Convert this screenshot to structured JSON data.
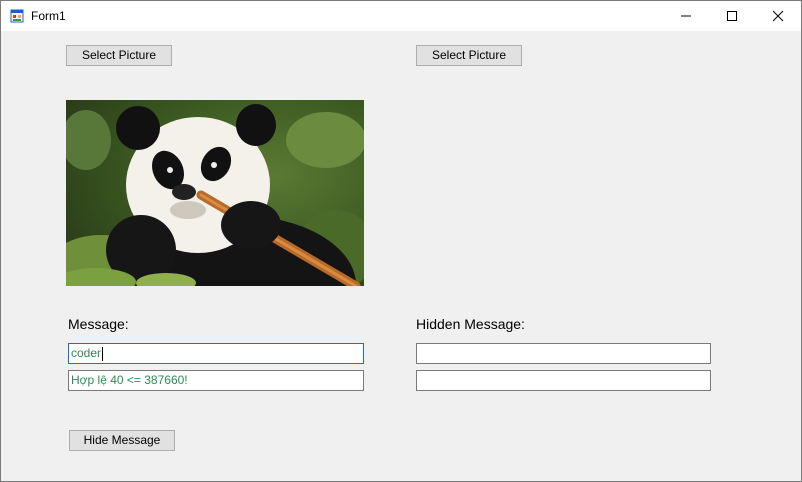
{
  "window": {
    "title": "Form1"
  },
  "left": {
    "select_label": "Select Picture",
    "message_label": "Message:",
    "message_value": "coder",
    "status_value": "Hợp lệ 40 <= 387660!",
    "hide_button": "Hide Message"
  },
  "right": {
    "select_label": "Select Picture",
    "hidden_label": "Hidden Message:",
    "hidden_value_1": "",
    "hidden_value_2": ""
  },
  "colors": {
    "status_text": "#2e8b57",
    "focus_border": "#0078d7"
  },
  "icons": [
    "app-form-icon",
    "minimize-icon",
    "maximize-icon",
    "close-icon"
  ]
}
